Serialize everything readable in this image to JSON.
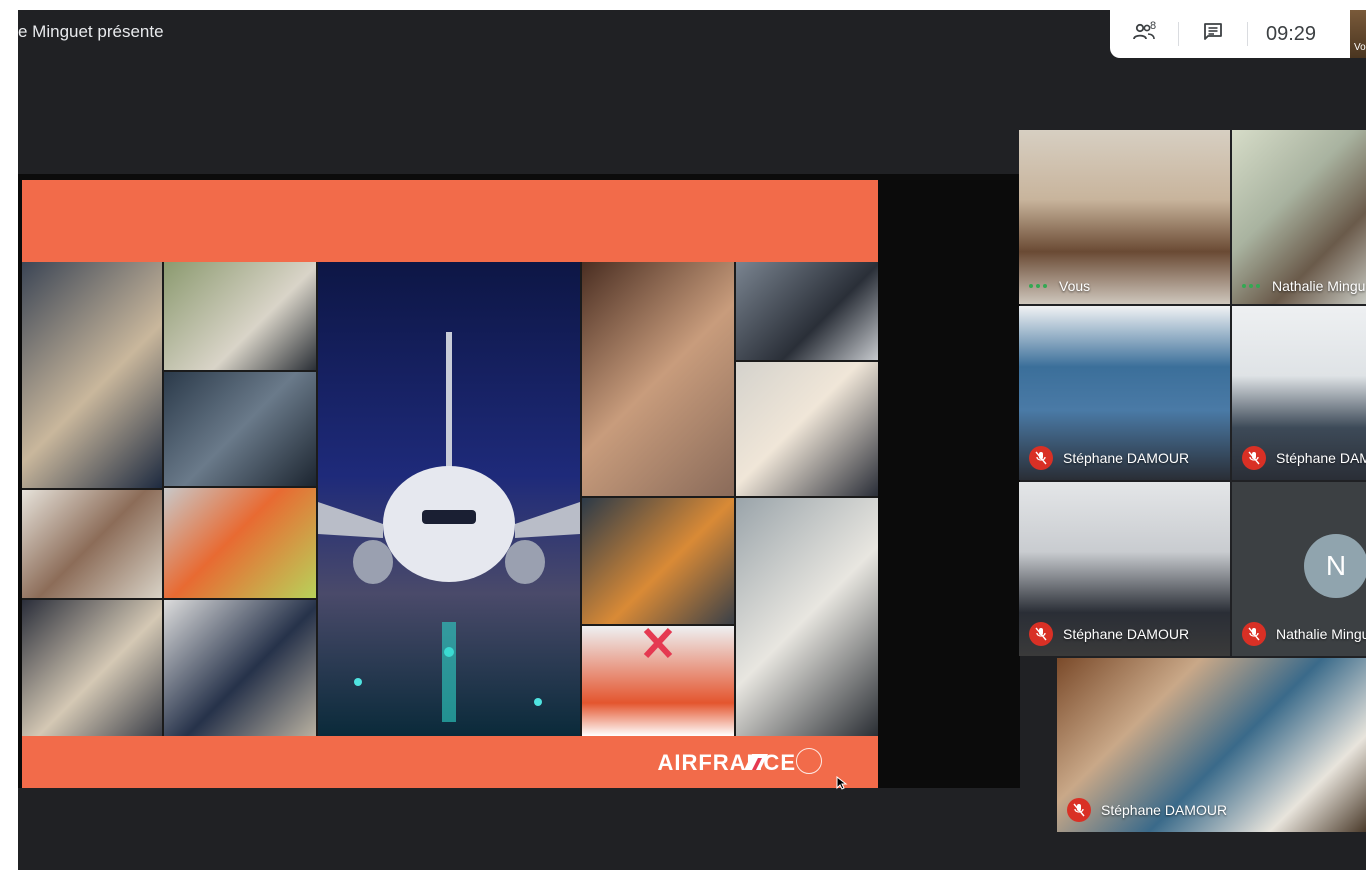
{
  "presenter": {
    "title": "e Minguet présente"
  },
  "top_controls": {
    "participants_count": "8",
    "clock": "09:29",
    "self_preview_label": "Vo"
  },
  "slide": {
    "brand": "AIRFRANCE"
  },
  "participants": [
    {
      "name": "Vous",
      "muted": false,
      "speaking": true
    },
    {
      "name": "Nathalie Mingu",
      "muted": false,
      "speaking": true
    },
    {
      "name": "Stéphane DAMOUR",
      "muted": true
    },
    {
      "name": "Stéphane DAM",
      "muted": true
    },
    {
      "name": "Stéphane DAMOUR",
      "muted": true
    },
    {
      "name": "Nathalie Mingu",
      "muted": true,
      "initial": "N"
    },
    {
      "name": "Stéphane DAMOUR",
      "muted": true
    }
  ],
  "colors": {
    "background": "#202124",
    "slide_accent": "#f26b4a",
    "mic_off": "#d93025",
    "speaking": "#34a853",
    "avatar_bg": "#90a4ae"
  },
  "icons": {
    "participants": "people-icon",
    "chat": "chat-icon",
    "mic_off": "mic-off-icon"
  }
}
